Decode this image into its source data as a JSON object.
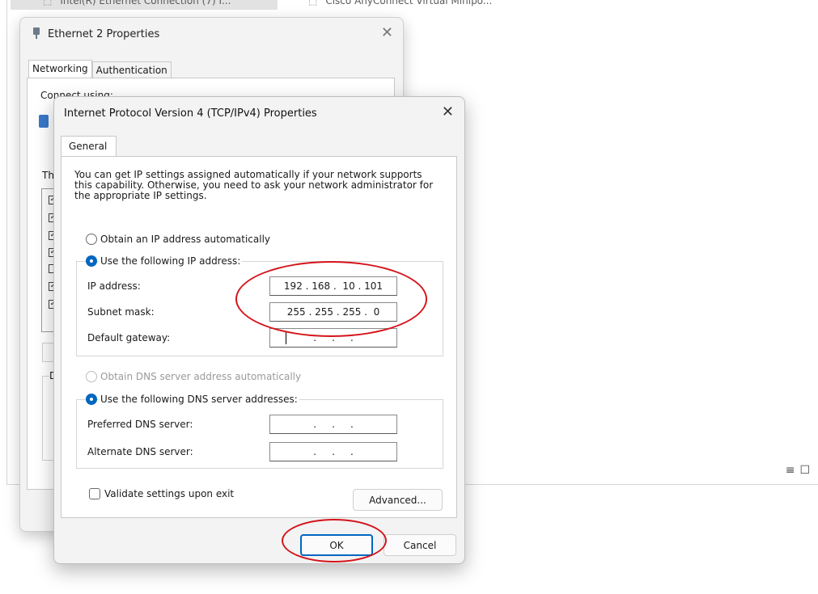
{
  "background_window": {
    "items": [
      "Intel(R) Ethernet Connection (7) I...",
      "Cisco AnyConnect Virtual Minipo..."
    ]
  },
  "ethernet_dialog": {
    "title": "Ethernet 2 Properties",
    "tabs": [
      "Networking",
      "Authentication"
    ],
    "connect_label": "Connect using:",
    "partial_label_th": "Th",
    "partial_label_d": "D",
    "checkbox_states": [
      true,
      true,
      true,
      true,
      false,
      true,
      true
    ]
  },
  "ipv4_dialog": {
    "title": "Internet Protocol Version 4 (TCP/IPv4) Properties",
    "tab": "General",
    "intro_text": "You can get IP settings assigned automatically if your network supports this capability. Otherwise, you need to ask your network administrator for the appropriate IP settings.",
    "ip_section": {
      "auto_label": "Obtain an IP address automatically",
      "manual_label": "Use the following IP address:",
      "selected": "manual",
      "fields": [
        {
          "label": "IP address:",
          "value": "192 . 168 .  10 . 101"
        },
        {
          "label": "Subnet mask:",
          "value": "255 . 255 . 255 .  0"
        },
        {
          "label": "Default gateway:",
          "value": "    .     .     .    "
        }
      ]
    },
    "dns_section": {
      "auto_label": "Obtain DNS server address automatically",
      "manual_label": "Use the following DNS server addresses:",
      "selected": "manual",
      "fields": [
        {
          "label": "Preferred DNS server:",
          "value": "    .     .     .    "
        },
        {
          "label": "Alternate DNS server:",
          "value": "    .     .     .    "
        }
      ]
    },
    "validate_label": "Validate settings upon exit",
    "validate_checked": false,
    "advanced_label": "Advanced...",
    "ok_label": "OK",
    "cancel_label": "Cancel",
    "accent_color": "#0067c0",
    "highlight_color": "#d4141b"
  }
}
